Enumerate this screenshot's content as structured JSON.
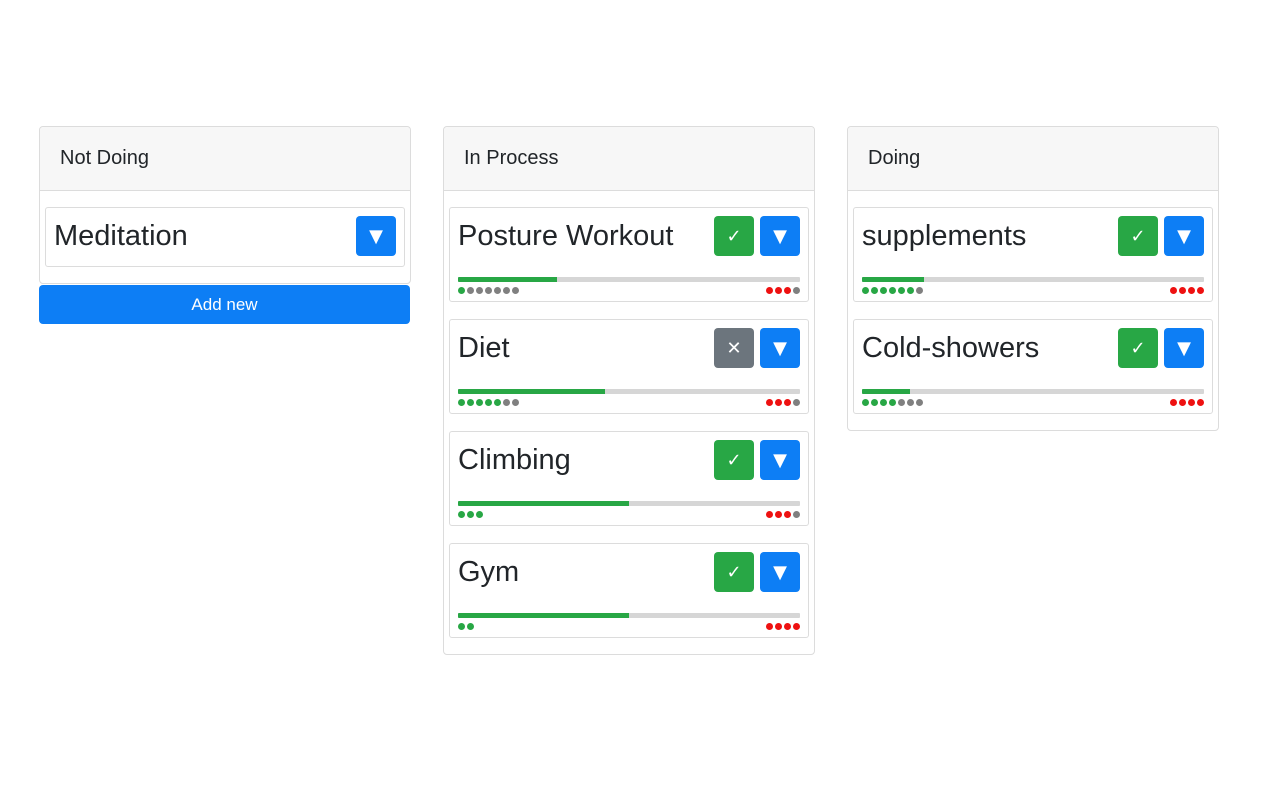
{
  "colors": {
    "green": "#28a745",
    "blue": "#0d7ef5",
    "grey_button": "#6c757d",
    "dot_grey": "#808080",
    "dot_red": "#ee1111",
    "track": "#d6d6d6"
  },
  "icons": {
    "check": "✓",
    "dropdown": "▼",
    "close": "✕"
  },
  "add_button_label": "Add new",
  "columns": [
    {
      "title": "Not Doing",
      "cards": [
        {
          "title": "Meditation",
          "action": "none",
          "has_progress": false
        }
      ]
    },
    {
      "title": "In Process",
      "cards": [
        {
          "title": "Posture Workout",
          "action": "check",
          "has_progress": true,
          "progress_percent": 29,
          "left_dots": [
            "g",
            "x",
            "x",
            "x",
            "x",
            "x",
            "x"
          ],
          "right_dots": [
            "r",
            "r",
            "r",
            "x"
          ]
        },
        {
          "title": "Diet",
          "action": "close",
          "has_progress": true,
          "progress_percent": 43,
          "left_dots": [
            "g",
            "g",
            "g",
            "g",
            "g",
            "x",
            "x"
          ],
          "right_dots": [
            "r",
            "r",
            "r",
            "x"
          ]
        },
        {
          "title": "Climbing",
          "action": "check",
          "has_progress": true,
          "progress_percent": 50,
          "left_dots": [
            "g",
            "g",
            "g"
          ],
          "right_dots": [
            "r",
            "r",
            "r",
            "x"
          ]
        },
        {
          "title": "Gym",
          "action": "check",
          "has_progress": true,
          "progress_percent": 50,
          "left_dots": [
            "g",
            "g"
          ],
          "right_dots": [
            "r",
            "r",
            "r",
            "r"
          ]
        }
      ]
    },
    {
      "title": "Doing",
      "cards": [
        {
          "title": "supplements",
          "action": "check",
          "has_progress": true,
          "progress_percent": 18,
          "left_dots": [
            "g",
            "g",
            "g",
            "g",
            "g",
            "g",
            "x"
          ],
          "right_dots": [
            "r",
            "r",
            "r",
            "r"
          ]
        },
        {
          "title": "Cold-showers",
          "action": "check",
          "has_progress": true,
          "progress_percent": 14,
          "left_dots": [
            "g",
            "g",
            "g",
            "g",
            "x",
            "x",
            "x"
          ],
          "right_dots": [
            "r",
            "r",
            "r",
            "r"
          ]
        }
      ]
    }
  ]
}
